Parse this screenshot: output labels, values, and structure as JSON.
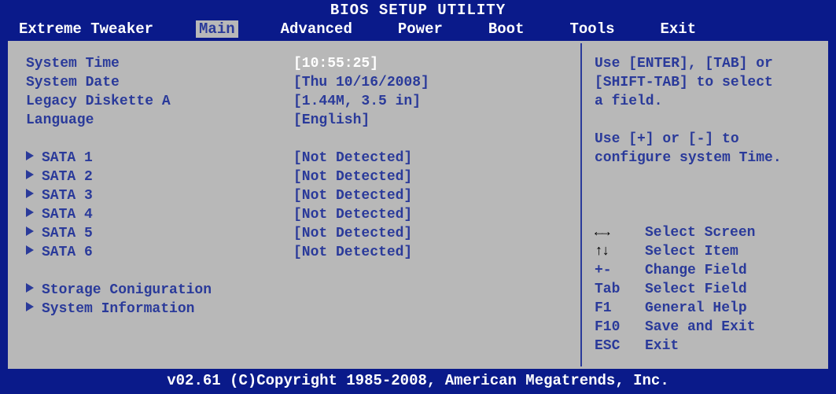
{
  "title": "BIOS SETUP UTILITY",
  "menu": {
    "items": [
      "Extreme Tweaker",
      "Main",
      "Advanced",
      "Power",
      "Boot",
      "Tools",
      "Exit"
    ],
    "active": "Main"
  },
  "settings": {
    "system_time": {
      "label": "System Time",
      "value": "[10:55:25]"
    },
    "system_date": {
      "label": "System Date",
      "value": "[Thu 10/16/2008]"
    },
    "legacy_diskette": {
      "label": "Legacy Diskette A",
      "value": "[1.44M, 3.5 in]"
    },
    "language": {
      "label": "Language",
      "value": "[English]"
    }
  },
  "sata": [
    {
      "label": "SATA 1",
      "value": "[Not Detected]"
    },
    {
      "label": "SATA 2",
      "value": "[Not Detected]"
    },
    {
      "label": "SATA 3",
      "value": "[Not Detected]"
    },
    {
      "label": "SATA 4",
      "value": "[Not Detected]"
    },
    {
      "label": "SATA 5",
      "value": "[Not Detected]"
    },
    {
      "label": "SATA 6",
      "value": "[Not Detected]"
    }
  ],
  "submenus": {
    "storage": "Storage Coniguration",
    "sysinfo": "System Information"
  },
  "help": {
    "line1": "Use [ENTER], [TAB] or",
    "line2": "[SHIFT-TAB] to select",
    "line3": "a field.",
    "line4": "Use [+] or [-] to",
    "line5": "configure system Time."
  },
  "keys": {
    "select_screen": "Select Screen",
    "select_item": "Select Item",
    "change_field_k": "+-",
    "change_field": "Change Field",
    "select_field_k": "Tab",
    "select_field": "Select Field",
    "general_help_k": "F1",
    "general_help": "General Help",
    "save_exit_k": "F10",
    "save_exit": "Save and Exit",
    "exit_k": "ESC",
    "exit": "Exit"
  },
  "footer": "v02.61 (C)Copyright 1985-2008, American Megatrends, Inc."
}
